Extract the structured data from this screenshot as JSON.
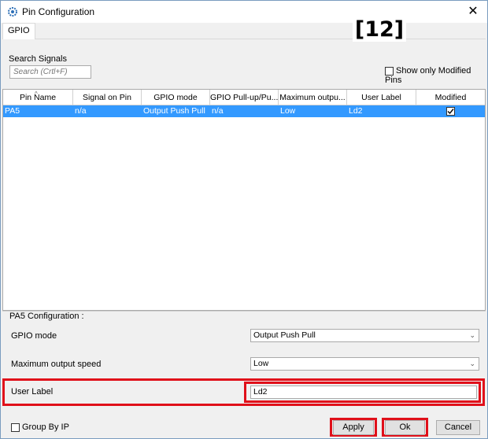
{
  "window": {
    "title": "Pin Configuration"
  },
  "tabs": [
    {
      "label": "GPIO"
    }
  ],
  "badge": {
    "text": "[12]"
  },
  "search": {
    "label": "Search Signals",
    "placeholder": "Search (Crtl+F)"
  },
  "filters": {
    "show_modified_label": "Show only Modified Pins",
    "show_modified_checked": false
  },
  "table": {
    "columns": [
      "Pin Name",
      "Signal on Pin",
      "GPIO mode",
      "GPIO Pull-up/Pu...",
      "Maximum outpu...",
      "User Label",
      "Modified"
    ],
    "rows": [
      {
        "pin_name": "PA5",
        "signal": "n/a",
        "gpio_mode": "Output Push Pull",
        "pull": "n/a",
        "max_speed": "Low",
        "user_label": "Ld2",
        "modified": true
      }
    ]
  },
  "config": {
    "title": "PA5 Configuration :",
    "gpio_mode_label": "GPIO mode",
    "gpio_mode_value": "Output Push Pull",
    "speed_label": "Maximum output speed",
    "speed_value": "Low",
    "user_label_label": "User Label",
    "user_label_value": "Ld2"
  },
  "footer": {
    "group_by_ip_label": "Group By IP",
    "group_by_ip_checked": false,
    "apply_label": "Apply",
    "ok_label": "Ok",
    "cancel_label": "Cancel"
  },
  "colors": {
    "selection": "#3399ff",
    "highlight_box": "#e0101a"
  }
}
